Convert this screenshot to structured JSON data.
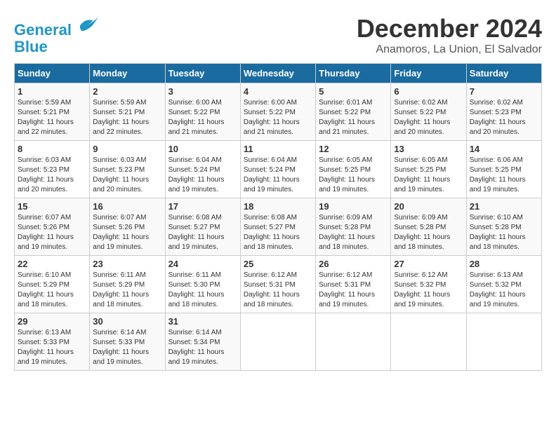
{
  "logo": {
    "line1": "General",
    "line2": "Blue"
  },
  "title": "December 2024",
  "subtitle": "Anamoros, La Union, El Salvador",
  "days_header": [
    "Sunday",
    "Monday",
    "Tuesday",
    "Wednesday",
    "Thursday",
    "Friday",
    "Saturday"
  ],
  "weeks": [
    [
      {
        "day": "1",
        "sunrise": "5:59 AM",
        "sunset": "5:21 PM",
        "daylight": "11 hours and 22 minutes."
      },
      {
        "day": "2",
        "sunrise": "5:59 AM",
        "sunset": "5:21 PM",
        "daylight": "11 hours and 22 minutes."
      },
      {
        "day": "3",
        "sunrise": "6:00 AM",
        "sunset": "5:22 PM",
        "daylight": "11 hours and 21 minutes."
      },
      {
        "day": "4",
        "sunrise": "6:00 AM",
        "sunset": "5:22 PM",
        "daylight": "11 hours and 21 minutes."
      },
      {
        "day": "5",
        "sunrise": "6:01 AM",
        "sunset": "5:22 PM",
        "daylight": "11 hours and 21 minutes."
      },
      {
        "day": "6",
        "sunrise": "6:02 AM",
        "sunset": "5:22 PM",
        "daylight": "11 hours and 20 minutes."
      },
      {
        "day": "7",
        "sunrise": "6:02 AM",
        "sunset": "5:23 PM",
        "daylight": "11 hours and 20 minutes."
      }
    ],
    [
      {
        "day": "8",
        "sunrise": "6:03 AM",
        "sunset": "5:23 PM",
        "daylight": "11 hours and 20 minutes."
      },
      {
        "day": "9",
        "sunrise": "6:03 AM",
        "sunset": "5:23 PM",
        "daylight": "11 hours and 20 minutes."
      },
      {
        "day": "10",
        "sunrise": "6:04 AM",
        "sunset": "5:24 PM",
        "daylight": "11 hours and 19 minutes."
      },
      {
        "day": "11",
        "sunrise": "6:04 AM",
        "sunset": "5:24 PM",
        "daylight": "11 hours and 19 minutes."
      },
      {
        "day": "12",
        "sunrise": "6:05 AM",
        "sunset": "5:25 PM",
        "daylight": "11 hours and 19 minutes."
      },
      {
        "day": "13",
        "sunrise": "6:05 AM",
        "sunset": "5:25 PM",
        "daylight": "11 hours and 19 minutes."
      },
      {
        "day": "14",
        "sunrise": "6:06 AM",
        "sunset": "5:25 PM",
        "daylight": "11 hours and 19 minutes."
      }
    ],
    [
      {
        "day": "15",
        "sunrise": "6:07 AM",
        "sunset": "5:26 PM",
        "daylight": "11 hours and 19 minutes."
      },
      {
        "day": "16",
        "sunrise": "6:07 AM",
        "sunset": "5:26 PM",
        "daylight": "11 hours and 19 minutes."
      },
      {
        "day": "17",
        "sunrise": "6:08 AM",
        "sunset": "5:27 PM",
        "daylight": "11 hours and 19 minutes."
      },
      {
        "day": "18",
        "sunrise": "6:08 AM",
        "sunset": "5:27 PM",
        "daylight": "11 hours and 18 minutes."
      },
      {
        "day": "19",
        "sunrise": "6:09 AM",
        "sunset": "5:28 PM",
        "daylight": "11 hours and 18 minutes."
      },
      {
        "day": "20",
        "sunrise": "6:09 AM",
        "sunset": "5:28 PM",
        "daylight": "11 hours and 18 minutes."
      },
      {
        "day": "21",
        "sunrise": "6:10 AM",
        "sunset": "5:28 PM",
        "daylight": "11 hours and 18 minutes."
      }
    ],
    [
      {
        "day": "22",
        "sunrise": "6:10 AM",
        "sunset": "5:29 PM",
        "daylight": "11 hours and 18 minutes."
      },
      {
        "day": "23",
        "sunrise": "6:11 AM",
        "sunset": "5:29 PM",
        "daylight": "11 hours and 18 minutes."
      },
      {
        "day": "24",
        "sunrise": "6:11 AM",
        "sunset": "5:30 PM",
        "daylight": "11 hours and 18 minutes."
      },
      {
        "day": "25",
        "sunrise": "6:12 AM",
        "sunset": "5:31 PM",
        "daylight": "11 hours and 18 minutes."
      },
      {
        "day": "26",
        "sunrise": "6:12 AM",
        "sunset": "5:31 PM",
        "daylight": "11 hours and 19 minutes."
      },
      {
        "day": "27",
        "sunrise": "6:12 AM",
        "sunset": "5:32 PM",
        "daylight": "11 hours and 19 minutes."
      },
      {
        "day": "28",
        "sunrise": "6:13 AM",
        "sunset": "5:32 PM",
        "daylight": "11 hours and 19 minutes."
      }
    ],
    [
      {
        "day": "29",
        "sunrise": "6:13 AM",
        "sunset": "5:33 PM",
        "daylight": "11 hours and 19 minutes."
      },
      {
        "day": "30",
        "sunrise": "6:14 AM",
        "sunset": "5:33 PM",
        "daylight": "11 hours and 19 minutes."
      },
      {
        "day": "31",
        "sunrise": "6:14 AM",
        "sunset": "5:34 PM",
        "daylight": "11 hours and 19 minutes."
      },
      null,
      null,
      null,
      null
    ]
  ]
}
